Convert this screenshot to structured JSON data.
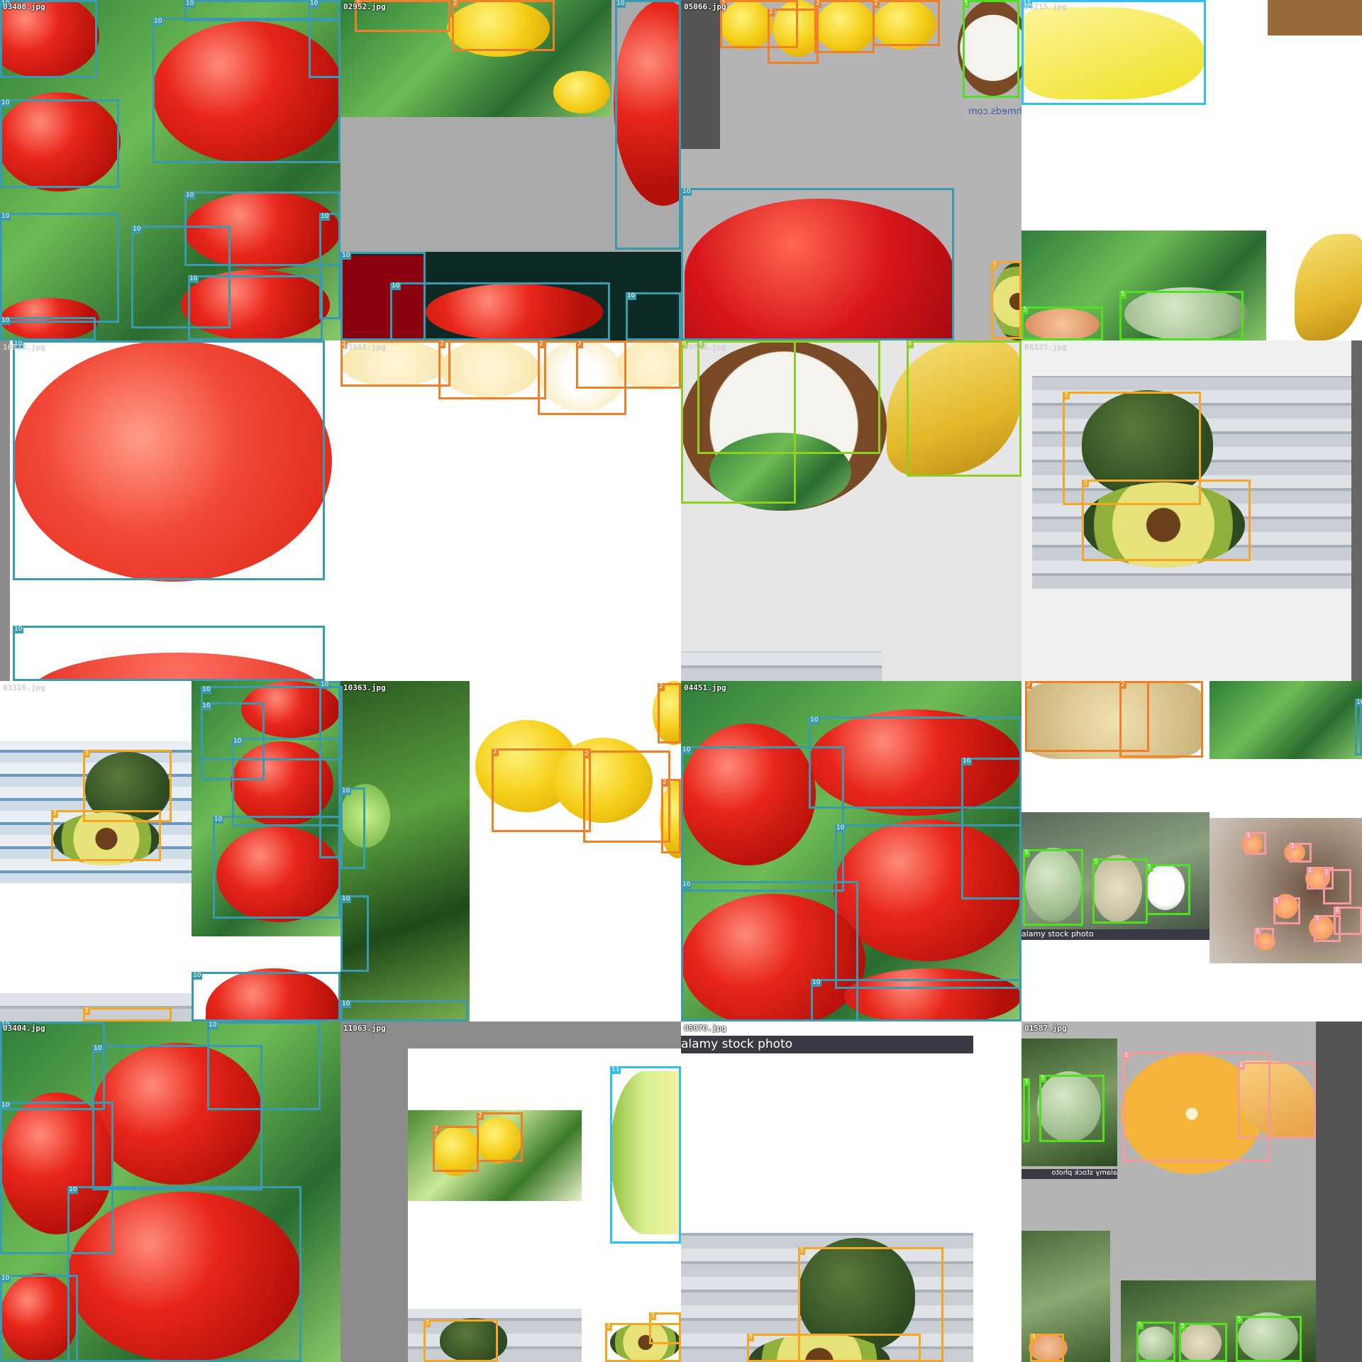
{
  "colors": {
    "class_1": "#f79a9a",
    "class_2": "#f08028",
    "class_3": "#f5a623",
    "class_5": "#50e020",
    "class_6": "#8ecf20",
    "class_10": "#3a9ab0",
    "class_11": "#30c0f0"
  },
  "tiles": [
    {
      "name": "tile-r1c1",
      "title": "03408.jpg",
      "tone": "dark-bg",
      "theme": "tomato-leaves"
    },
    {
      "name": "tile-r1c2",
      "title": "02952.jpg",
      "tone": "dark-bg",
      "theme": "lemon-gray"
    },
    {
      "name": "tile-r1c3",
      "title": "05066.jpg",
      "tone": "dark-bg",
      "theme": "tomato-gray"
    },
    {
      "name": "tile-r1c4",
      "title": "05215.jpg",
      "tone": "light",
      "theme": "misc-white"
    },
    {
      "name": "tile-r2c1",
      "title": "10523.jpg",
      "tone": "light",
      "theme": "big-tomato"
    },
    {
      "name": "tile-r2c2",
      "title": "03851.jpg",
      "tone": "light",
      "theme": "pale-lemons"
    },
    {
      "name": "tile-r2c3",
      "title": "09720.jpg",
      "tone": "light",
      "theme": "coconut-banana"
    },
    {
      "name": "tile-r2c4",
      "title": "08333.jpg",
      "tone": "light",
      "theme": "avocado-wood"
    },
    {
      "name": "tile-r3c1",
      "title": "03316.jpg",
      "tone": "light",
      "theme": "avocado-tomato"
    },
    {
      "name": "tile-r3c2",
      "title": "10363.jpg",
      "tone": "dark-bg",
      "theme": "green-lemons"
    },
    {
      "name": "tile-r3c3",
      "title": "04451.jpg",
      "tone": "dark-bg",
      "theme": "tomato-close"
    },
    {
      "name": "tile-r3c4",
      "title": "",
      "tone": "light",
      "theme": "melons-fruits"
    },
    {
      "name": "tile-r4c1",
      "title": "03404.jpg",
      "tone": "dark-bg",
      "theme": "tomato-close"
    },
    {
      "name": "tile-r4c2",
      "title": "11063.jpg",
      "tone": "dark-bg",
      "theme": "lemons-gray"
    },
    {
      "name": "tile-r4c3",
      "title": "05070.jpg",
      "tone": "dark-bg",
      "theme": "avocado-stock"
    },
    {
      "name": "tile-r4c4",
      "title": "01587.jpg",
      "tone": "dark-bg",
      "theme": "orange-gray"
    }
  ],
  "watermarks": {
    "freshmeds": "freshmeds.com",
    "alamy_1": "alamy stock photo",
    "alamy_2": "alamy stock photo",
    "alamy_3": "alamy stock photo"
  },
  "labels": [
    "1",
    "2",
    "3",
    "5",
    "6",
    "10",
    "11"
  ]
}
